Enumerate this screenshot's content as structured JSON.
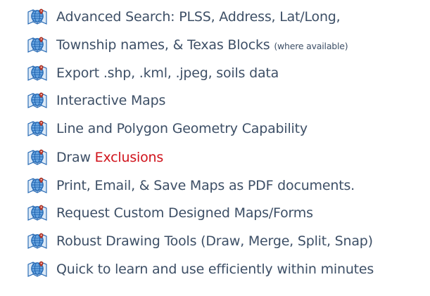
{
  "icon": "globe-map-icon",
  "colors": {
    "text": "#3d4f66",
    "highlight": "#d0121b",
    "icon_blue": "#1e63b0",
    "icon_light": "#6aa6e0"
  },
  "items": [
    {
      "text": "Advanced Search: PLSS, Address, Lat/Long,"
    },
    {
      "text": "Township names, & Texas Blocks",
      "note": "(where available)"
    },
    {
      "text": "Export .shp, .kml, .jpeg, soils data"
    },
    {
      "text": "Interactive Maps"
    },
    {
      "text": "Line and Polygon Geometry Capability"
    },
    {
      "prefix": "Draw",
      "highlight": "Exclusions"
    },
    {
      "text": "Print, Email, & Save Maps as PDF documents."
    },
    {
      "text": "Request Custom Designed Maps/Forms"
    },
    {
      "text": "Robust Drawing Tools (Draw, Merge, Split, Snap)"
    },
    {
      "text": "Quick to learn and use efficiently within minutes"
    }
  ]
}
